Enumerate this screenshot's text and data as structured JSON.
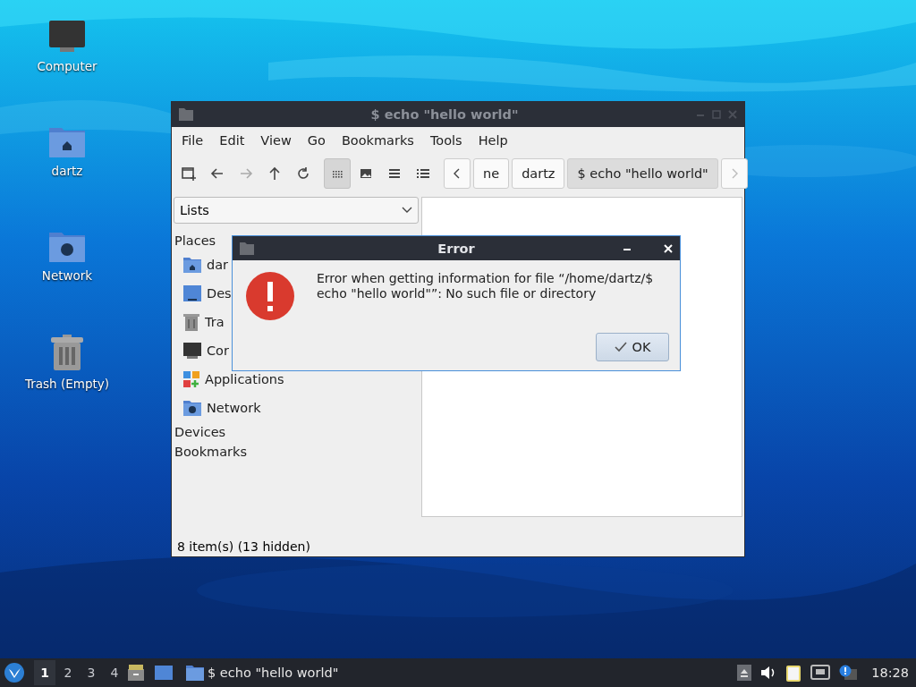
{
  "desktop_icons": [
    {
      "label": "Computer",
      "kind": "computer"
    },
    {
      "label": "dartz",
      "kind": "home"
    },
    {
      "label": "Network",
      "kind": "network"
    },
    {
      "label": "Trash (Empty)",
      "kind": "trash"
    }
  ],
  "file_manager": {
    "title": "$ echo \"hello world\"",
    "menu": [
      "File",
      "Edit",
      "View",
      "Go",
      "Bookmarks",
      "Tools",
      "Help"
    ],
    "toolbar": [
      {
        "kind": "new-tab",
        "disabled": false
      },
      {
        "kind": "back",
        "disabled": false
      },
      {
        "kind": "forward",
        "disabled": true
      },
      {
        "kind": "up",
        "disabled": false
      },
      {
        "kind": "reload",
        "disabled": false
      }
    ],
    "view_modes": [
      {
        "kind": "icons",
        "selected": true
      },
      {
        "kind": "thumbnails",
        "selected": false
      },
      {
        "kind": "compact",
        "selected": false
      },
      {
        "kind": "detailed",
        "selected": false
      }
    ],
    "breadcrumbs": [
      {
        "label": "ne",
        "selected": false
      },
      {
        "label": "dartz",
        "selected": false
      },
      {
        "label": "$ echo \"hello world\"",
        "selected": true
      }
    ],
    "side_pane_mode": "Lists",
    "sections": [
      {
        "label": "Places",
        "items": [
          {
            "label": "dar",
            "kind": "home"
          },
          {
            "label": "Des",
            "kind": "desktop"
          },
          {
            "label": "Tra",
            "kind": "trash"
          },
          {
            "label": "Cor",
            "kind": "computer"
          },
          {
            "label": "Applications",
            "kind": "apps"
          },
          {
            "label": "Network",
            "kind": "network"
          }
        ]
      },
      {
        "label": "Devices"
      },
      {
        "label": "Bookmarks"
      }
    ],
    "status": "8 item(s) (13 hidden)"
  },
  "dialog": {
    "title": "Error",
    "message": "Error when getting information for file “/home/dartz/$ echo \"hello world\"”: No such file or directory",
    "button": "OK"
  },
  "taskbar": {
    "workspaces": [
      {
        "label": "1",
        "selected": true
      },
      {
        "label": "2",
        "selected": false
      },
      {
        "label": "3",
        "selected": false
      },
      {
        "label": "4",
        "selected": false
      }
    ],
    "task": "$ echo \"hello world\"",
    "clock": "18:28"
  }
}
